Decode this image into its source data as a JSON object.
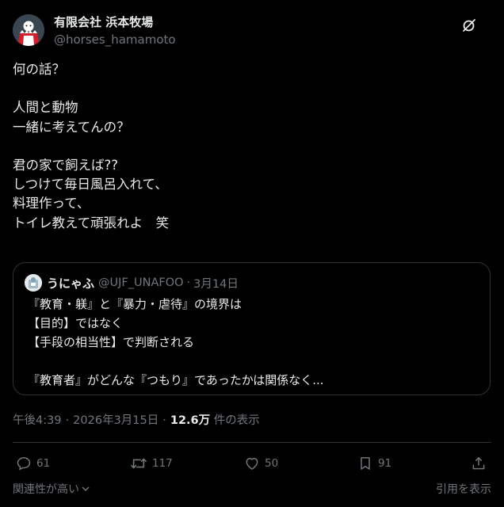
{
  "author": {
    "display_name": "有限会社 浜本牧場",
    "handle": "@horses_hamamoto"
  },
  "post": {
    "text": "何の話？\n\n人間と動物\n一緒に考えてんの？\n\n君の家で飼えば??\nしつけて毎日風呂入れて、\n料理作って、\nトイレ教えて頑張れよ　笑"
  },
  "quoted_post": {
    "display_name": "うにゃふ",
    "handle": "@UJF_UNAFOO",
    "separator": "·",
    "date": "3月14日",
    "text": "『教育・躾』と『暴力・虐待』の境界は\n【目的】ではなく\n【手段の相当性】で判断される\n\n『教育者』がどんな『つもり』であったかは関係なく..."
  },
  "meta": {
    "time": "午後4:39",
    "sep1": "·",
    "date": "2026年3月15日",
    "sep2": "·",
    "views": "12.6万",
    "views_label": "件の表示"
  },
  "actions": {
    "replies": "61",
    "reposts": "117",
    "likes": "50",
    "bookmarks": "91"
  },
  "footer": {
    "relevance": "関連性が高い",
    "quotes_link": "引用を表示"
  },
  "colors": {
    "background": "#000000",
    "text": "#e7e9ea",
    "muted": "#71767b",
    "border": "#2f3336"
  },
  "icons": [
    "grok-icon",
    "reply-icon",
    "repost-icon",
    "like-icon",
    "bookmark-icon",
    "share-icon",
    "chevron-down-icon"
  ]
}
